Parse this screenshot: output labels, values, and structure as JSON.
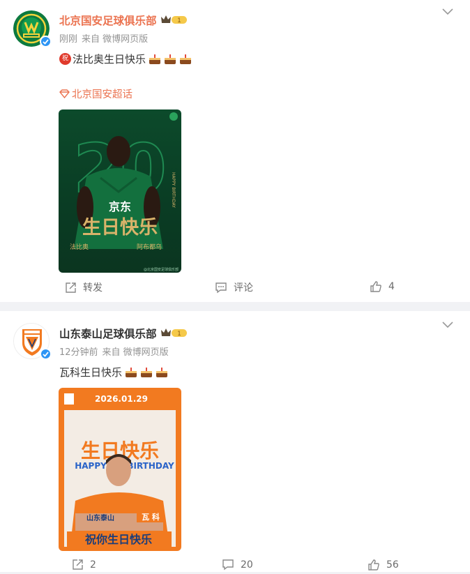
{
  "posts": [
    {
      "author": "北京国安足球俱乐部",
      "member_level": "1",
      "time": "刚刚",
      "source": "来自 微博网页版",
      "text": "法比奥生日快乐",
      "text_prefix_emoji": "祝",
      "emoji_after": "cake x3",
      "topic": "北京国安超话",
      "image": {
        "number": "20",
        "title": "生日快乐",
        "sponsor": "京东",
        "player_left_name": "法比奥",
        "player_right_name": "阿布都乌",
        "side_text": "HAPPY BIRTHDAY",
        "watermark": "@北京国安足球俱乐部"
      },
      "actions": {
        "repost": "转发",
        "comment": "评论",
        "like": "4"
      },
      "accent_color": "#eb7350"
    },
    {
      "author": "山东泰山足球俱乐部",
      "member_level": "1",
      "time": "12分钟前",
      "source": "来自 微博网页版",
      "text": "瓦科生日快乐",
      "emoji_after": "cake x3",
      "image": {
        "date": "2026.01.29",
        "title": "生日快乐",
        "happy": "HAPPY",
        "birthday": "BIRTHDAY",
        "name_tag": "瓦 科",
        "blessing": "祝你生日快乐",
        "sponsor": "山东泰山"
      },
      "actions": {
        "repost": "2",
        "comment": "20",
        "like": "56"
      },
      "accent_color": "#f27a20"
    }
  ]
}
